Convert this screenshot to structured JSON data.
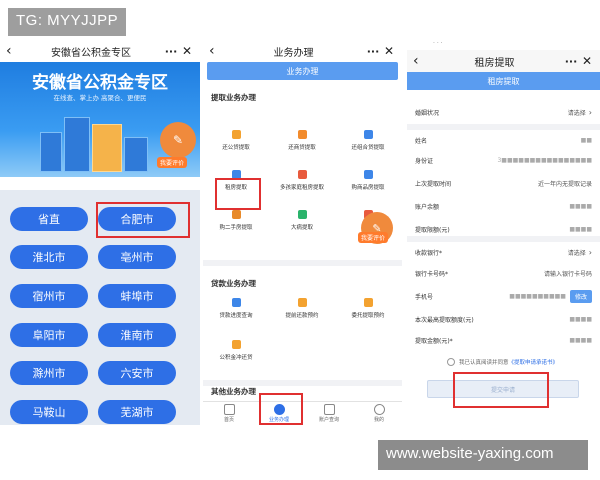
{
  "watermark_tl": "TG: MYYJJPP",
  "watermark_br": "www.website-yaxing.com",
  "panel1": {
    "nav_title": "安徽省公积金专区",
    "banner_title": "安徽省公积金专区",
    "banner_sub": "在线查、掌上办  高聚合、更便民",
    "eval_label": "我要评价",
    "cities": [
      "省直",
      "合肥市",
      "淮北市",
      "亳州市",
      "宿州市",
      "蚌埠市",
      "阜阳市",
      "淮南市",
      "滁州市",
      "六安市",
      "马鞍山",
      "芜湖市"
    ]
  },
  "panel2": {
    "nav_title": "业务办理",
    "tab_label": "业务办理",
    "section1": "提取业务办理",
    "items1": [
      "还公贷提取",
      "还商贷提取",
      "还组合贷提取",
      "租房提取",
      "多孩家庭租房提取",
      "购商品房提取",
      "购二手房提取",
      "大病提取",
      "更多"
    ],
    "section2": "贷款业务办理",
    "items2": [
      "贷款进度查询",
      "提前还款预约",
      "委托提取预约",
      "公积金冲还贷"
    ],
    "section3": "其他业务办理",
    "eval_label": "我要评价",
    "tabs": [
      "首页",
      "业务办理",
      "账户查询",
      "我的"
    ]
  },
  "panel3": {
    "status_bar": "· · ·",
    "nav_title": "租房提取",
    "tab_label": "租房提取",
    "rows": [
      {
        "label": "婚姻状况",
        "value": "请选择",
        "arrow": true
      },
      {
        "label": "姓名",
        "value": "■■"
      },
      {
        "label": "身份证",
        "value": "3■■■■■■■■■■■■■■■■"
      },
      {
        "label": "上次提取时间",
        "value": "近一年内无提取记录"
      },
      {
        "label": "账户余额",
        "value": "■■■■"
      },
      {
        "label": "提取限额(元)",
        "value": "■■■■"
      },
      {
        "label": "收款银行*",
        "value": "请选择",
        "arrow": true
      },
      {
        "label": "银行卡号码*",
        "value": "请输入银行卡号码"
      },
      {
        "label": "手机号",
        "value": "■■■■■■■■■■"
      },
      {
        "label": "本次最高提取额度(元)",
        "value": "■■■■"
      },
      {
        "label": "提取金额(元)*",
        "value": "■■■■"
      }
    ],
    "modify_label": "修改",
    "agree_text": "我已认真阅读并同意",
    "agree_link": "《提取申请承诺书》",
    "submit_label": "提交申请"
  }
}
